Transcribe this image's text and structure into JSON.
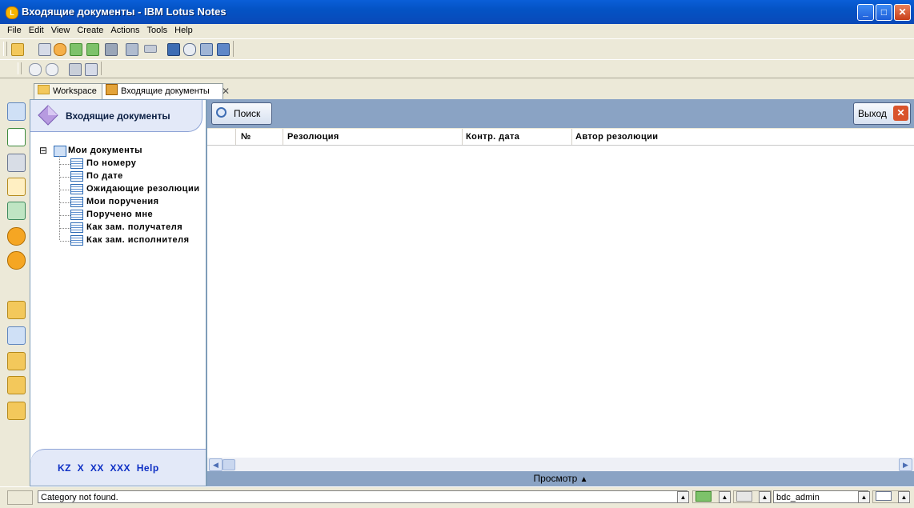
{
  "window": {
    "title": "Входящие документы - IBM Lotus Notes",
    "app_icon_letter": "L"
  },
  "window_controls": {
    "minimize": "_",
    "maximize": "□",
    "close": "✕"
  },
  "menu": [
    "File",
    "Edit",
    "View",
    "Create",
    "Actions",
    "Tools",
    "Help"
  ],
  "tabs": [
    {
      "label": "Workspace",
      "icon": "folder-icon"
    },
    {
      "label": "Входящие документы",
      "icon": "database-icon",
      "close": "✕"
    }
  ],
  "navigator": {
    "header_title": "Входящие документы",
    "tree_root": {
      "expander": "⊟",
      "label": "Мои документы"
    },
    "tree_items": [
      "По номеру",
      "По дате",
      "Ожидающие резолюции",
      "Мои поручения",
      "Поручено мне",
      "Как зам. получателя",
      "Как зам. исполнителя"
    ],
    "footer_links": "KZ  X  XX  XXX  Help"
  },
  "action_bar": {
    "search_button": "Поиск",
    "exit_button": "Выход",
    "exit_glyph": "✕"
  },
  "view": {
    "columns": [
      "№",
      "Резолюция",
      "Контр. дата",
      "Автор резолюции"
    ],
    "rows": []
  },
  "scroll": {
    "left_arrow": "◀",
    "right_arrow": "▶"
  },
  "preview_bar": {
    "label": "Просмотр",
    "arrow": "▲"
  },
  "status": {
    "message": "Category not found.",
    "user": "bdc_admin",
    "dropdown_arrow": "▲"
  },
  "colors": {
    "titlebar": "#0453c4",
    "action_bar": "#8aa3c4",
    "navigator_header": "#e3e9f8",
    "footer_link": "#0c2ec4",
    "exit_accent": "#c8401a"
  }
}
